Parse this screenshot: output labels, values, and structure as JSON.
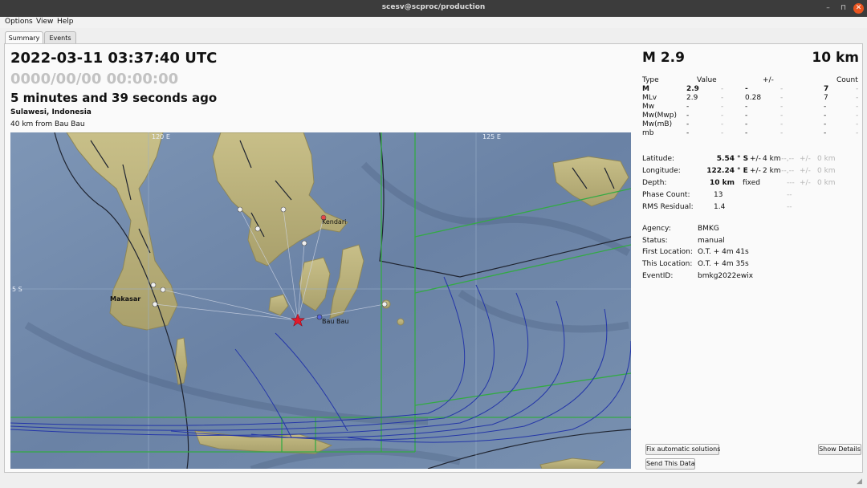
{
  "window": {
    "title": "scesv@scproc/production",
    "controls": [
      "–",
      "⊓",
      "✕"
    ]
  },
  "menu": [
    "Options",
    "View",
    "Help"
  ],
  "tabs": [
    {
      "label": "Summary",
      "active": true
    },
    {
      "label": "Events",
      "active": false
    }
  ],
  "event": {
    "origin_time": "2022-03-11 03:37:40 UTC",
    "reference_time": "0000/00/00  00:00:00",
    "time_ago": "5 minutes and 39 seconds ago",
    "region": "Sulawesi, Indonesia",
    "nearby": "40 km from Bau Bau"
  },
  "summary": {
    "magnitude": "M 2.9",
    "depth": "10 km"
  },
  "magnitudes": {
    "header": {
      "type": "Type",
      "value": "Value",
      "uncertainty": "+/-",
      "count": "Count"
    },
    "rows": [
      {
        "type": "M",
        "value": "2.9",
        "d1": "-",
        "uncertainty": "-",
        "d2": "-",
        "count": "7",
        "d3": "-",
        "bold": true
      },
      {
        "type": "MLv",
        "value": "2.9",
        "d1": "-",
        "uncertainty": "0.28",
        "d2": "-",
        "count": "7",
        "d3": "-",
        "bold": false
      },
      {
        "type": "Mw",
        "value": "-",
        "d1": "-",
        "uncertainty": "-",
        "d2": "-",
        "count": "-",
        "d3": "-",
        "bold": false
      },
      {
        "type": "Mw(Mwp)",
        "value": "-",
        "d1": "-",
        "uncertainty": "-",
        "d2": "-",
        "count": "-",
        "d3": "-",
        "bold": false
      },
      {
        "type": "Mw(mB)",
        "value": "-",
        "d1": "-",
        "uncertainty": "-",
        "d2": "-",
        "count": "-",
        "d3": "-",
        "bold": false
      },
      {
        "type": "mb",
        "value": "-",
        "d1": "-",
        "uncertainty": "-",
        "d2": "-",
        "count": "-",
        "d3": "-",
        "bold": false
      }
    ]
  },
  "location": {
    "latitude": {
      "label": "Latitude:",
      "value": "5.54",
      "unit": "° S",
      "pm": "+/-",
      "error": "4 km",
      "g1": "---,--",
      "g2": "+/-",
      "g3": "0 km"
    },
    "longitude": {
      "label": "Longitude:",
      "value": "122.24",
      "unit": "° E",
      "pm": "+/-",
      "error": "2 km",
      "g1": "---,--",
      "g2": "+/-",
      "g3": "0 km"
    },
    "depth": {
      "label": "Depth:",
      "value": "10 km",
      "fixed": "fixed",
      "g1": "---",
      "g2": "+/-",
      "g3": "0 km"
    },
    "phase_count": {
      "label": "Phase Count:",
      "value": "13",
      "g": "--"
    },
    "rms": {
      "label": "RMS Residual:",
      "value": "1.4",
      "g": "--"
    }
  },
  "info": [
    {
      "label": "Agency:",
      "value": "BMKG"
    },
    {
      "label": "Status:",
      "value": "manual"
    },
    {
      "label": "First Location:",
      "value": "O.T. + 4m 41s"
    },
    {
      "label": "This Location:",
      "value": "O.T. + 4m 35s"
    },
    {
      "label": "EventID:",
      "value": "bmkg2022ewix"
    }
  ],
  "buttons": {
    "fix": "Fix automatic solutions",
    "details": "Show Details",
    "send": "Send This Data"
  },
  "map": {
    "labels": {
      "lon120": "120 E",
      "lon125": "125 E",
      "lat5": "5 S",
      "city1": "Makasar",
      "city2": "Kendari",
      "city3": "Bau Bau"
    },
    "colors": {
      "sea": "#6f87a8",
      "land": "#b9b07a",
      "epicenter": "#e01a2b",
      "grid": "#33aa44",
      "contour": "#2436a8"
    }
  }
}
